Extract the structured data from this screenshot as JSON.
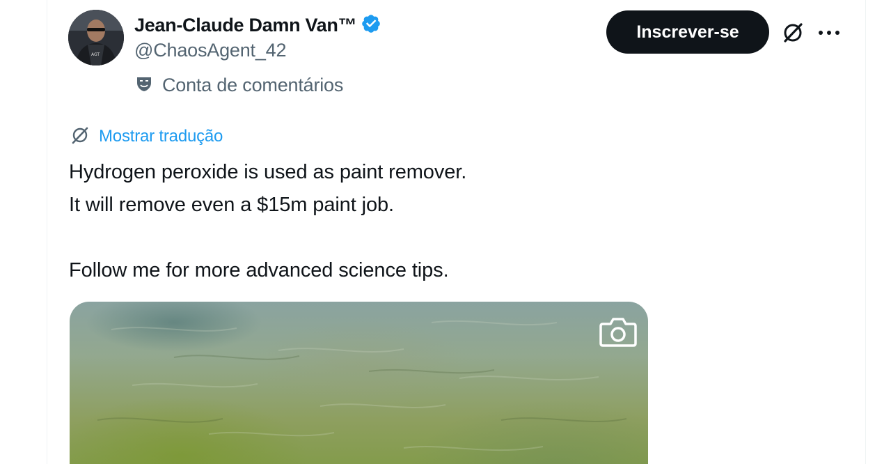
{
  "author": {
    "display_name": "Jean-Claude Damn Van™",
    "handle": "@ChaosAgent_42",
    "verified": true,
    "affiliation_label": "Conta de comentários"
  },
  "actions": {
    "subscribe_label": "Inscrever-se",
    "grok_icon": "grok-icon",
    "more_icon": "more-dots-icon"
  },
  "translation": {
    "label": "Mostrar tradução"
  },
  "tweet": {
    "lines": [
      "Hydrogen peroxide is used as paint remover.",
      "It will remove even a $15m paint job.",
      "Follow me for more advanced science tips."
    ]
  },
  "media": {
    "overlay_icon": "camera-icon"
  },
  "colors": {
    "text_primary": "#0f1419",
    "text_secondary": "#536471",
    "link": "#1d9bf0",
    "verified_badge": "#1d9bf0",
    "button_bg": "#0f1419",
    "button_text": "#ffffff"
  }
}
